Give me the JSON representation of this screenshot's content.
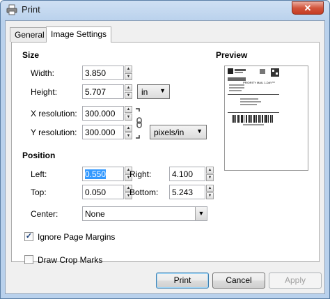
{
  "window": {
    "title": "Print",
    "close_label": "✕"
  },
  "tabs": [
    {
      "label": "General"
    },
    {
      "label": "Image Settings"
    }
  ],
  "size": {
    "header": "Size",
    "width_label": "Width:",
    "width_value": "3.850",
    "height_label": "Height:",
    "height_value": "5.707",
    "size_unit": "in",
    "xres_label": "X resolution:",
    "xres_value": "300.000",
    "yres_label": "Y resolution:",
    "yres_value": "300.000",
    "res_unit": "pixels/in"
  },
  "position": {
    "header": "Position",
    "left_label": "Left:",
    "left_value": "0.550",
    "right_label": "Right:",
    "right_value": "4.100",
    "top_label": "Top:",
    "top_value": "0.050",
    "bottom_label": "Bottom:",
    "bottom_value": "5.243",
    "center_label": "Center:",
    "center_value": "None"
  },
  "options": {
    "ignore_margins_label": "Ignore Page Margins",
    "ignore_margins_checked": true,
    "crop_marks_label": "Draw Crop Marks",
    "crop_marks_checked": false
  },
  "preview": {
    "header": "Preview",
    "label_title": "PRIORITY MAIL 1-DAY™"
  },
  "buttons": {
    "print": "Print",
    "cancel": "Cancel",
    "apply": "Apply"
  }
}
